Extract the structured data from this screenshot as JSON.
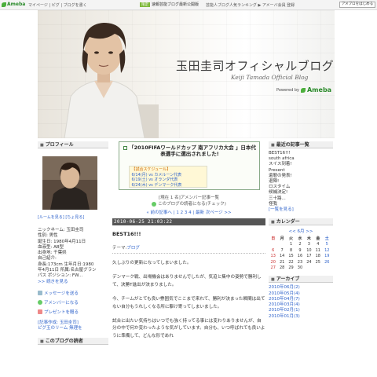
{
  "topbar": {
    "logo": "Ameba",
    "links": "マイページ | ピグ | ブログを書く",
    "promo_badge": "限定",
    "promo_text": "速報芸能ブログ最新公開版",
    "promo_text2": "芸能人ブログ人気ランキング ▶ アメーバ会員 登録",
    "button": "アメブロをはじめる"
  },
  "header": {
    "title": "玉田圭司オフィシャルブログ",
    "subtitle": "Keiji Tamada Official Blog",
    "powered_by": "Powered by",
    "brand": "Ameba"
  },
  "left": {
    "profile_heading": "プロフィール",
    "profile_link": "[ルームを見る]  [ちょ見る]",
    "profile_lines": [
      "ニックネーム: 玉田圭司",
      "性別: 男性",
      "誕生日: 1980年4月11日",
      "血液型: AB型",
      "出身地: 千葉県",
      "自己紹介:",
      "身長:173cm 生年月日:1980年4月11日 所属:名古屋グランパス ポジション: FW..."
    ],
    "profile_more": ">> 続きを見る",
    "actions": [
      "メッセージを送る",
      "アメンバーになる",
      "プレゼントを贈る"
    ],
    "links": [
      "[記事作成: 玉田圭司]",
      "ピグ玉のリーム 無理を"
    ],
    "readers_heading": "このブログの読者"
  },
  "main": {
    "promo_title": "「2010FIFAワールドカップ 南アフリカ大会 」日本代表選手に選出されました!",
    "schedule_label": "【試合スケジュール】",
    "schedule": [
      "6/14(月) vs カメルーン代表",
      "6/19(土) vs オランダ代表",
      "6/24(木) vs デンマーク代表"
    ],
    "sub_link1": "[現在 1 名]アメンバー記事一覧",
    "sub_link2": "このブログの読者になる(チェック)",
    "pager": "« 前の記事へ | 1 2 3 4 | 最新  次ページ >>",
    "date": "2010-06-25 21:03:22",
    "entry_title": "BEST16!!!",
    "theme_label": "テーマ:",
    "theme_value": "ブログ",
    "paragraphs": [
      "久しぶりの更新になってしまいました。",
      "デンマーク戦、出場機会はありませんでしたが、気迫と集中の姿勢で勝利して、決勝T進出が決まりました。",
      "今、チームがとても良い雰囲気でここまで来れて、勝利が決まった瞬間は出てない自分もうれしくなる所に駆け寄ってしまいました。",
      "試合に出たい気持ちはいつでも強く持ってる事には変わりありませんが、自分の中で何か変わったような気がしています。自分も、いつ呼ばれても良いように準備して、どんな形であれ"
    ]
  },
  "right": {
    "recent_heading": "最近の記事一覧",
    "recent": [
      "BEST16!!!",
      "south africa",
      "スイス到着!",
      "Present",
      "還暦の発表!",
      "退陣!",
      "ロスタイム",
      "候補決定!",
      "三十路...",
      "怪我"
    ],
    "recent_more": "[一覧を見る]",
    "calendar_heading": "カレンダー",
    "calendar_nav": "<< 6月 >>",
    "weekdays": [
      "日",
      "月",
      "火",
      "水",
      "木",
      "金",
      "土"
    ],
    "calendar_rows": [
      [
        "",
        "",
        "1",
        "2",
        "3",
        "4",
        "5"
      ],
      [
        "6",
        "7",
        "8",
        "9",
        "10",
        "11",
        "12"
      ],
      [
        "13",
        "14",
        "15",
        "16",
        "17",
        "18",
        "19"
      ],
      [
        "20",
        "21",
        "22",
        "23",
        "24",
        "25",
        "26"
      ],
      [
        "27",
        "28",
        "29",
        "30",
        "",
        "",
        ""
      ]
    ],
    "archive_heading": "アーカイブ",
    "archive": [
      "2010年06月(2)",
      "2010年05月(4)",
      "2010年04月(7)",
      "2010年03月(4)",
      "2010年02月(1)",
      "2010年01月(3)"
    ]
  },
  "colors": {
    "link": "#3366cc",
    "ameba_green": "#2a8a2a",
    "date_bar": "#555555"
  }
}
